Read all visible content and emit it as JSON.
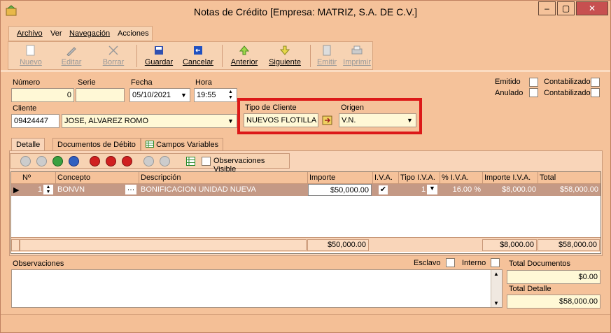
{
  "window": {
    "title": "Notas de Crédito [Empresa: MATRIZ, S.A. DE C.V.]",
    "min_label": "–",
    "max_label": "▢",
    "close_label": "✕"
  },
  "menu": [
    "Archivo",
    "Ver",
    "Navegación",
    "Acciones"
  ],
  "toolbar": {
    "nuevo": "Nuevo",
    "editar": "Editar",
    "borrar": "Borrar",
    "guardar": "Guardar",
    "cancelar": "Cancelar",
    "anterior": "Anterior",
    "siguiente": "Siguiente",
    "emitir": "Emitir",
    "imprimir": "Imprimir"
  },
  "form": {
    "numero_label": "Número",
    "numero_value": "0",
    "serie_label": "Serie",
    "serie_value": "",
    "fecha_label": "Fecha",
    "fecha_value": "05/10/2021",
    "hora_label": "Hora",
    "hora_value": "19:55",
    "cliente_label": "Cliente",
    "cliente_code": "09424447",
    "cliente_name": "JOSE, ALVAREZ ROMO",
    "tipo_cliente_label": "Tipo de Cliente",
    "tipo_cliente_value": "NUEVOS FLOTILLA",
    "origen_label": "Origen",
    "origen_value": "V.N.",
    "emitido_label": "Emitido",
    "anulado_label": "Anulado",
    "contabilizado_label": "Contabilizado"
  },
  "tabs": [
    "Detalle",
    "Documentos de Débito",
    "Campos Variables"
  ],
  "gridbar": {
    "obs_visible_label": "Observaciones Visible"
  },
  "grid": {
    "headers": [
      "Nº",
      "Concepto",
      "Descripción",
      "Importe",
      "I.V.A.",
      "Tipo I.V.A.",
      "% I.V.A.",
      "Importe I.V.A.",
      "Total"
    ],
    "row": {
      "n": "1",
      "concepto": "BONVN",
      "descripcion": "BONIFICACION UNIDAD NUEVA",
      "importe": "$50,000.00",
      "tipo_iva": "1",
      "pct_iva": "16.00 %",
      "importe_iva": "$8,000.00",
      "total": "$58,000.00"
    },
    "footer": {
      "importe": "$50,000.00",
      "importe_iva": "$8,000.00",
      "total": "$58,000.00"
    }
  },
  "bottom": {
    "observaciones_label": "Observaciones",
    "esclavo_label": "Esclavo",
    "interno_label": "Interno",
    "total_documentos_label": "Total Documentos",
    "total_documentos_value": "$0.00",
    "total_detalle_label": "Total Detalle",
    "total_detalle_value": "$58,000.00"
  }
}
